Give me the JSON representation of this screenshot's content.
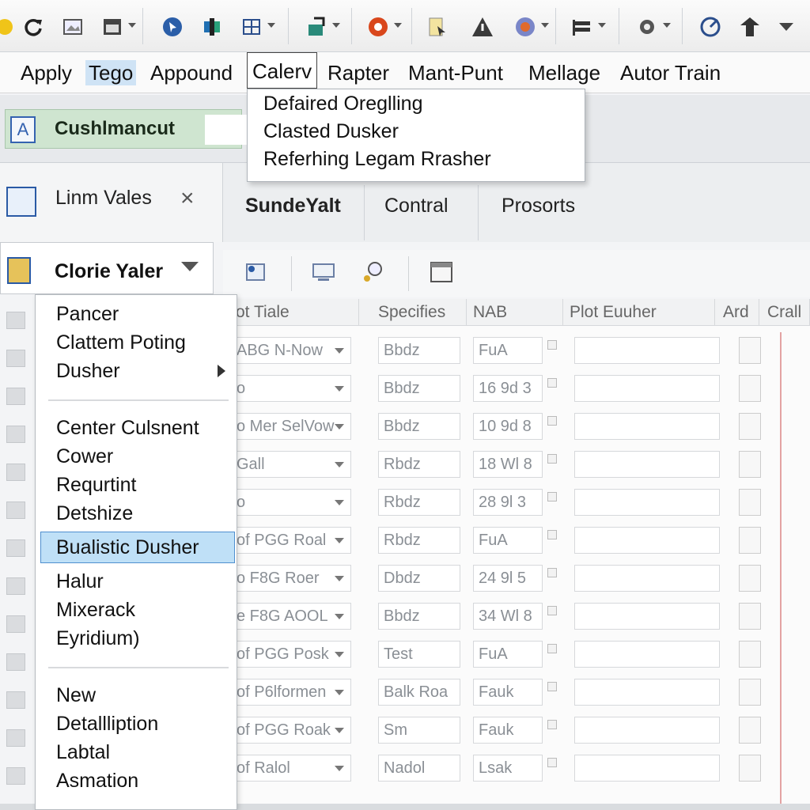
{
  "menubar": {
    "items": [
      "Apply",
      "Tego",
      "Appound",
      "Calerv",
      "Rapter",
      "Mant-Punt",
      "Mellage",
      "Autor Train"
    ]
  },
  "calerv_menu": {
    "items": [
      "Defaired Oreglling",
      "Clasted Dusker",
      "Referhing Legam Rrasher"
    ]
  },
  "ribbon": {
    "namebox_label": "Cushlmancut"
  },
  "panel": {
    "title": "Linm Vales",
    "close_glyph": "×"
  },
  "row2_buttons": [
    "SundeYalt",
    "Contral",
    "Prosorts"
  ],
  "left_select": {
    "label": "Clorie Yaler"
  },
  "context_menu": {
    "group1": [
      "Pancer",
      "Clattem Poting",
      "Dusher"
    ],
    "group2": [
      "Center Culsnent",
      "Cower",
      "Requrtint",
      "Detshize",
      "Bualistic Dusher",
      "Halur",
      "Mixerack",
      "Eyridium)"
    ],
    "group3": [
      "New",
      "Detallliption",
      "Labtal",
      "Asmation"
    ],
    "highlighted": "Bualistic Dusher"
  },
  "grid": {
    "headers": [
      "ot Tiale",
      "Specifies",
      "NAB",
      "Plot Euuher",
      "Ard",
      "Crall"
    ],
    "rows": [
      {
        "c1": "ABG N-Now",
        "c2": "Bbdz",
        "c3": "FuA"
      },
      {
        "c1": "o",
        "c2": "Bbdz",
        "c3": "16 9d 3"
      },
      {
        "c1": "o Mer SelVow",
        "c2": "Bbdz",
        "c3": "10 9d 8"
      },
      {
        "c1": "Gall",
        "c2": "Rbdz",
        "c3": "18 Wl 8"
      },
      {
        "c1": "o",
        "c2": "Rbdz",
        "c3": "28 9l 3"
      },
      {
        "c1": "of PGG Roal",
        "c2": "Rbdz",
        "c3": "FuA"
      },
      {
        "c1": "o F8G Roer",
        "c2": "Dbdz",
        "c3": "24 9l 5"
      },
      {
        "c1": "e F8G AOOL",
        "c2": "Bbdz",
        "c3": "34 Wl 8"
      },
      {
        "c1": "of PGG Posk",
        "c2": "Test",
        "c3": "FuA"
      },
      {
        "c1": "of P6lformen",
        "c2": "Balk Roa",
        "c3": "Fauk"
      },
      {
        "c1": "of PGG Roak",
        "c2": "Sm",
        "c3": "Fauk"
      },
      {
        "c1": "of Ralol",
        "c2": "Nadol",
        "c3": "Lsak"
      }
    ]
  },
  "colors": {
    "accent": "#2a5aa5",
    "namebox_bg": "#cfe5d0",
    "highlight": "#bfe0f7"
  }
}
